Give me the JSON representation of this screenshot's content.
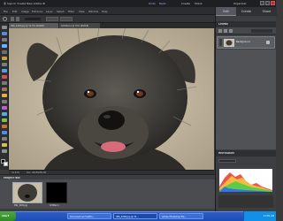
{
  "app": {
    "title": "Ⓑ   Sign In   Create New Adobe ID",
    "panel_toggle_icon": "panel-icon"
  },
  "menus": [
    "File",
    "Edit",
    "Image",
    "Enhance",
    "Layer",
    "Select",
    "Filter",
    "View",
    "Window",
    "Help"
  ],
  "title_buttons": [
    "Undo",
    "Redo",
    "Create",
    "Share",
    "Organizer"
  ],
  "document": {
    "tab1": "IMG_4209.jpg @ 31.5% (RGB/8)",
    "tab2": "Untitled-1 @ 75% (RGB/8)"
  },
  "right_panel": {
    "tabs": [
      {
        "label": "Edit",
        "active": true
      },
      {
        "label": "Create",
        "active": false
      },
      {
        "label": "Share",
        "active": false
      }
    ],
    "layers_title": "LAYERS",
    "layer_name": "Background",
    "histogram_title": "HISTOGRAM",
    "histogram_colors": [
      "#e63a2a",
      "#ffd23c",
      "#3ed04a",
      "#2d6bff"
    ]
  },
  "status": {
    "zoom": "31.52%",
    "doc": "Doc: 28.2M/28.2M"
  },
  "project_bin": {
    "title": "PROJECT BIN",
    "items": [
      {
        "label": "IMG_4209.jpg",
        "kind": "photo"
      },
      {
        "label": "Untitled-1",
        "kind": "black"
      }
    ]
  },
  "taskbar": {
    "start": "start",
    "buttons": [
      "Document and Settin...",
      "IMG_4209.jpg @ 31...",
      "Adobe Photoshop Ele..."
    ],
    "clock": "11:59 AM"
  }
}
